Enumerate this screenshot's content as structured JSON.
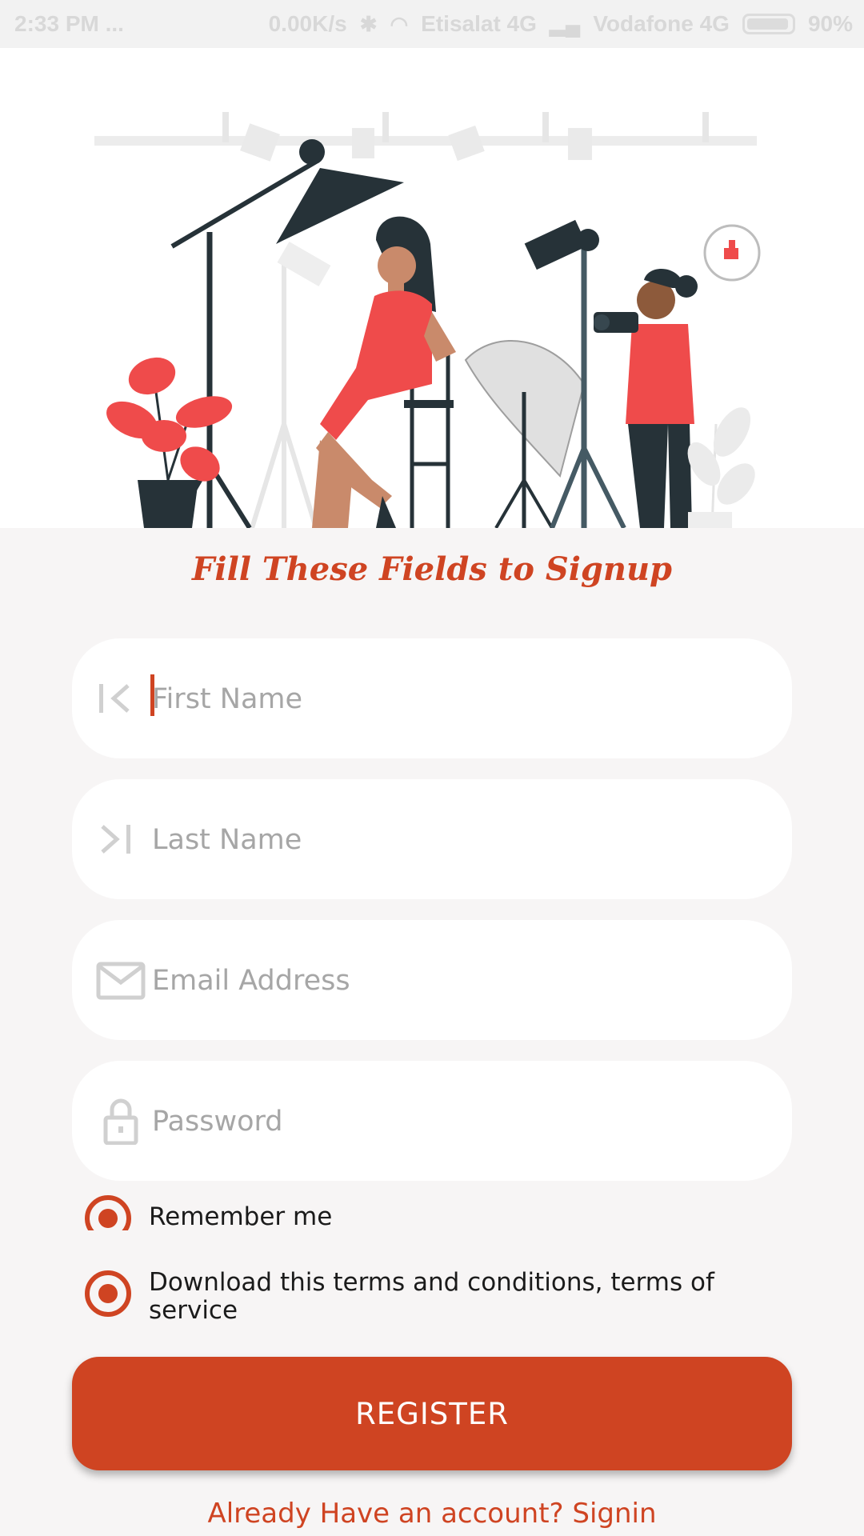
{
  "status_bar": {
    "time": "2:33 PM",
    "dots": "...",
    "speed": "0.00K/s",
    "carrier1": "Etisalat 4G",
    "carrier2": "Vodafone 4G",
    "battery": "90%"
  },
  "signup": {
    "title": "Fill These Fields to Signup",
    "first_name_placeholder": "First Name",
    "last_name_placeholder": "Last Name",
    "email_placeholder": "Email Address",
    "password_placeholder": "Password",
    "remember_label": "Remember me",
    "remember_checked": true,
    "terms_label": "Download this terms and conditions, terms of service",
    "terms_checked": true,
    "register_label": "REGISTER",
    "signin_label": "Already Have an account? Signin"
  },
  "colors": {
    "accent": "#cf4422",
    "background": "#f7f5f5",
    "field": "#ffffff"
  },
  "icons": [
    "first-page-icon",
    "last-page-icon",
    "mail-icon",
    "lock-icon"
  ]
}
